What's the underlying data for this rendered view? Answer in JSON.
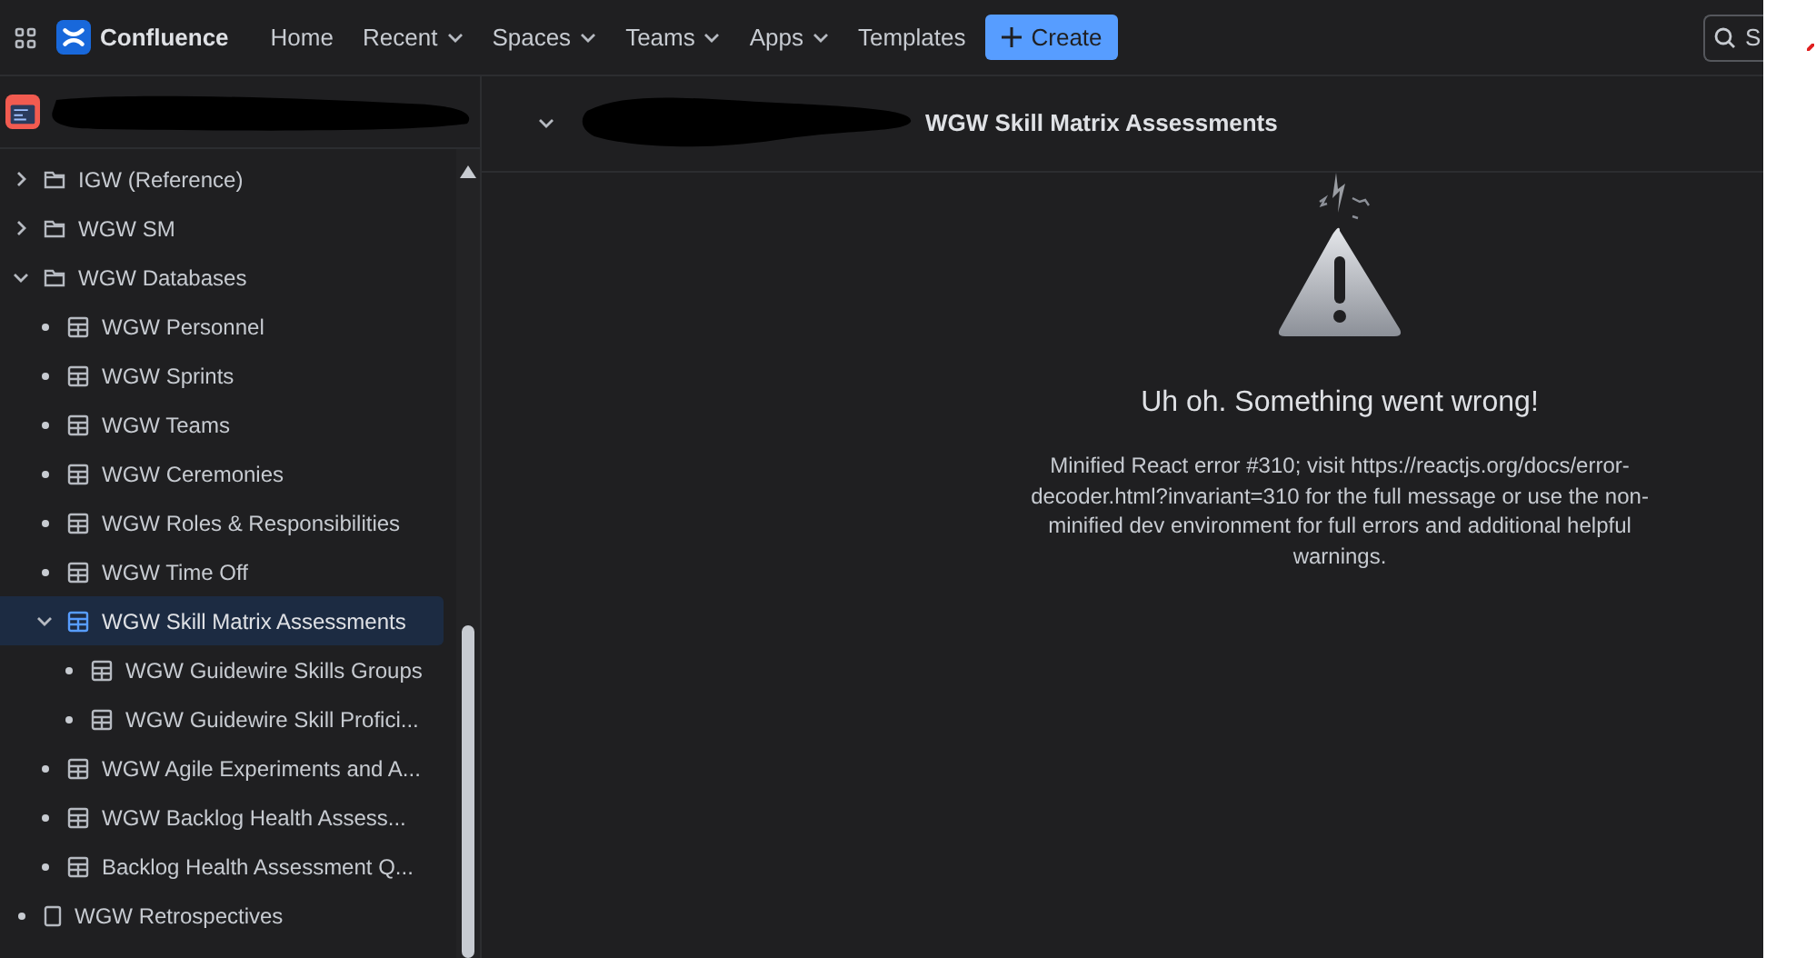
{
  "nav": {
    "product": "Confluence",
    "items": [
      {
        "label": "Home",
        "dropdown": false
      },
      {
        "label": "Recent",
        "dropdown": true
      },
      {
        "label": "Spaces",
        "dropdown": true
      },
      {
        "label": "Teams",
        "dropdown": true
      },
      {
        "label": "Apps",
        "dropdown": true
      },
      {
        "label": "Templates",
        "dropdown": false
      }
    ],
    "create_button": "Create",
    "search": {
      "placeholder": "S"
    }
  },
  "sidebar": {
    "tree": [
      {
        "label": "IGW (Reference)",
        "kind": "folder",
        "expanded": false,
        "selected": false
      },
      {
        "label": "WGW SM",
        "kind": "folder",
        "expanded": false,
        "selected": false
      },
      {
        "label": "WGW Databases",
        "kind": "folder",
        "expanded": true,
        "selected": false,
        "children": [
          {
            "label": "WGW Personnel",
            "kind": "database",
            "selected": false
          },
          {
            "label": "WGW Sprints",
            "kind": "database",
            "selected": false
          },
          {
            "label": "WGW Teams",
            "kind": "database",
            "selected": false
          },
          {
            "label": "WGW Ceremonies",
            "kind": "database",
            "selected": false
          },
          {
            "label": "WGW Roles & Responsibilities",
            "kind": "database",
            "selected": false
          },
          {
            "label": "WGW Time Off",
            "kind": "database",
            "selected": false
          },
          {
            "label": "WGW Skill Matrix Assessments",
            "kind": "database",
            "expanded": true,
            "selected": true,
            "children": [
              {
                "label": "WGW Guidewire Skills Groups",
                "kind": "database",
                "selected": false
              },
              {
                "label": "WGW Guidewire Skill Profici...",
                "kind": "database",
                "selected": false
              }
            ]
          },
          {
            "label": "WGW Agile Experiments and A...",
            "kind": "database",
            "selected": false
          },
          {
            "label": "WGW Backlog Health Assess...",
            "kind": "database",
            "selected": false
          },
          {
            "label": "Backlog Health Assessment Q...",
            "kind": "database",
            "selected": false
          }
        ]
      },
      {
        "label": "WGW Retrospectives",
        "kind": "page",
        "selected": false
      }
    ]
  },
  "page": {
    "title": "WGW Skill Matrix Assessments",
    "error": {
      "heading": "Uh oh. Something went wrong!",
      "message": "Minified React error #310; visit https://reactjs.org/docs/error-decoder.html?invariant=310 for the full message or use the non-minified dev environment for full errors and additional helpful warnings."
    }
  }
}
